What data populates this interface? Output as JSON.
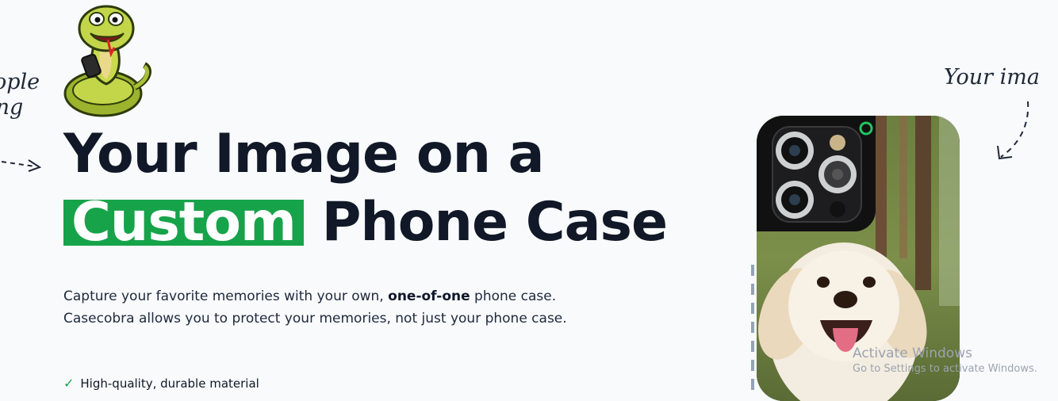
{
  "annotations": {
    "left_note_line1": "ople",
    "left_note_line2": "ing",
    "right_note": "Your ima"
  },
  "hero": {
    "title_line1": "Your Image on a",
    "title_highlight": "Custom",
    "title_rest": "Phone Case",
    "description_part1": "Capture your favorite memories with your own, ",
    "description_bold": "one-of-one",
    "description_part2": " phone case. Casecobra allows you to protect your memories, not just your phone case.",
    "features": [
      "High-quality, durable material"
    ]
  },
  "icons": {
    "mascot": "snake-mascot-icon",
    "check": "check-icon"
  },
  "colors": {
    "accent": "#16a34a",
    "background": "#f8fafc",
    "text": "#111827"
  },
  "system_overlay": {
    "line1": "Activate Windows",
    "line2": "Go to Settings to activate Windows."
  }
}
